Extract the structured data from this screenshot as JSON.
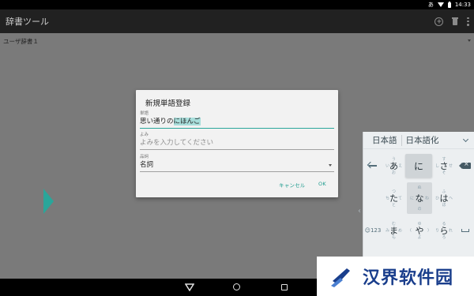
{
  "status_bar": {
    "ime_indicator": "あ",
    "time": "14:33",
    "icons": [
      "wifi-icon",
      "battery-icon"
    ]
  },
  "app_bar": {
    "title": "辞書ツール",
    "actions": [
      "add-icon",
      "delete-icon",
      "more-icon"
    ]
  },
  "dictionary": {
    "selected": "ユーザ辞書１"
  },
  "dialog": {
    "title": "新規単語登録",
    "word": {
      "label": "単語",
      "value_prefix": "思い通りの",
      "value_highlight": "にほんご"
    },
    "reading": {
      "label": "よみ",
      "placeholder": "よみを入力してください"
    },
    "pos": {
      "label": "品詞",
      "value": "名詞"
    },
    "buttons": {
      "cancel": "キャンセル",
      "ok": "OK"
    }
  },
  "keyboard": {
    "candidates": [
      "日本語",
      "日本語化"
    ],
    "keys": {
      "a": {
        "main": "あ",
        "top": "う",
        "left": "い",
        "right": "え",
        "bottom": "お"
      },
      "ni": {
        "main": "に"
      },
      "sa": {
        "main": "さ",
        "top": "す",
        "left": "し",
        "right": "せ",
        "bottom": "そ"
      },
      "ta": {
        "main": "た",
        "top": "つ",
        "left": "ち",
        "right": "て",
        "bottom": "と"
      },
      "na": {
        "main": "な",
        "top": "ぬ",
        "left": "に",
        "right": "ね",
        "bottom": "の"
      },
      "ha": {
        "main": "は",
        "top": "ふ",
        "left": "ひ",
        "right": "へ",
        "bottom": "ほ"
      },
      "ma": {
        "main": "ま",
        "top": "む",
        "left": "み",
        "right": "め",
        "bottom": "も"
      },
      "ya": {
        "main": "や",
        "top": "ゆ",
        "left": "(",
        "right": ")",
        "bottom": "よ"
      },
      "ra": {
        "main": "ら",
        "top": "る",
        "left": "り",
        "right": "れ",
        "bottom": "ろ"
      },
      "sym": "☺123"
    }
  },
  "watermark": {
    "text": "汉界软件园"
  },
  "colors": {
    "accent": "#2aa69a",
    "app_bar": "#212121",
    "dim_background": "#7a7a7a",
    "dialog_bg": "#f2f2f2",
    "keyboard_bg": "#eceff1",
    "watermark_text": "#1a3e8c"
  }
}
